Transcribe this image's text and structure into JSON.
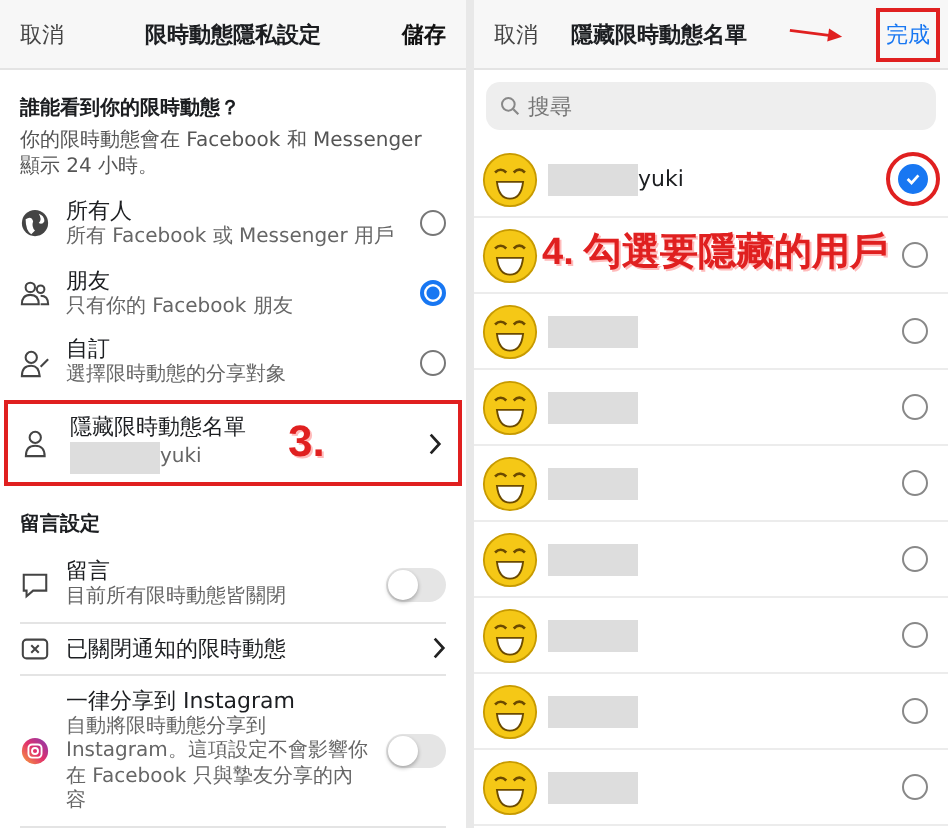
{
  "left": {
    "header": {
      "cancel": "取消",
      "title": "限時動態隱私設定",
      "save": "儲存"
    },
    "audience": {
      "heading": "誰能看到你的限時動態？",
      "description": "你的限時動態會在 Facebook 和 Messenger 顯示 24 小時。"
    },
    "options": [
      {
        "kind": "globe",
        "title": "所有人",
        "subtitle": "所有 Facebook 或 Messenger 用戶",
        "selected": false
      },
      {
        "kind": "friends",
        "title": "朋友",
        "subtitle": "只有你的 Facebook 朋友",
        "selected": true
      },
      {
        "kind": "custom",
        "title": "自訂",
        "subtitle": "選擇限時動態的分享對象",
        "selected": false
      }
    ],
    "hide_list": {
      "title": "隱藏限時動態名單",
      "value": "yuki",
      "annotation": "3."
    },
    "comments_heading": "留言設定",
    "settings": [
      {
        "kind": "toggle",
        "title": "留言",
        "subtitle": "目前所有限時動態皆關閉",
        "on": false
      },
      {
        "kind": "link",
        "title": "已關閉通知的限時動態"
      },
      {
        "kind": "toggle",
        "title": "一律分享到 Instagram",
        "subtitle": "自動將限時動態分享到 Instagram。這項設定不會影響你在 Facebook 只與摯友分享的內容",
        "on": false
      }
    ]
  },
  "right": {
    "header": {
      "cancel": "取消",
      "title": "隱藏限時動態名單",
      "done": "完成"
    },
    "search": {
      "placeholder": "搜尋"
    },
    "annotation": "4. 勾選要隱藏的用戶",
    "people": [
      {
        "name": "yuki",
        "selected": true
      },
      {
        "selected": false
      },
      {
        "selected": false
      },
      {
        "selected": false
      },
      {
        "selected": false
      },
      {
        "selected": false
      },
      {
        "selected": false
      },
      {
        "selected": false
      },
      {
        "selected": false
      }
    ]
  }
}
